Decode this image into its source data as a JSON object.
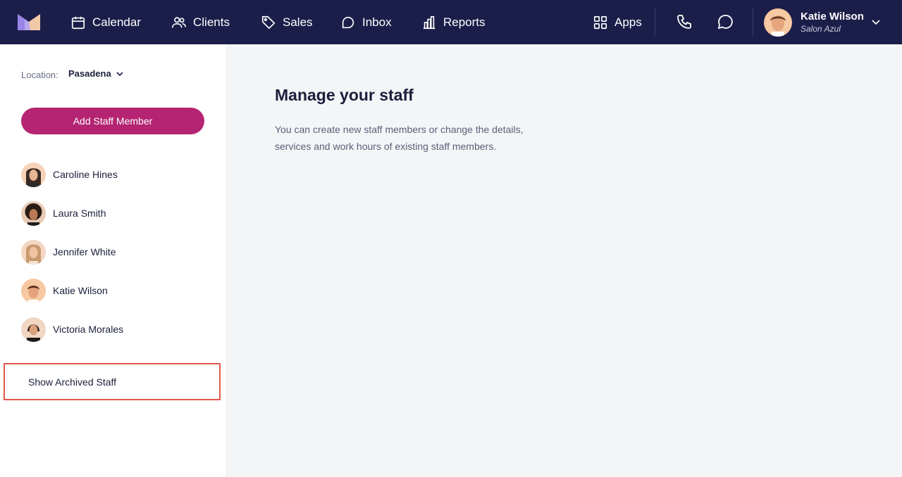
{
  "nav": {
    "items": [
      {
        "label": "Calendar",
        "icon": "calendar-icon"
      },
      {
        "label": "Clients",
        "icon": "users-icon"
      },
      {
        "label": "Sales",
        "icon": "tag-icon"
      },
      {
        "label": "Inbox",
        "icon": "chat-icon"
      },
      {
        "label": "Reports",
        "icon": "bar-chart-icon"
      }
    ],
    "apps_label": "Apps",
    "phone_icon": "phone-icon",
    "message_icon": "message-icon"
  },
  "user": {
    "name": "Katie Wilson",
    "salon": "Salon Azul"
  },
  "sidebar": {
    "location_label": "Location:",
    "location_value": "Pasadena",
    "add_button": "Add Staff Member",
    "staff": [
      {
        "name": "Caroline Hines"
      },
      {
        "name": "Laura Smith"
      },
      {
        "name": "Jennifer White"
      },
      {
        "name": "Katie Wilson"
      },
      {
        "name": "Victoria Morales"
      }
    ],
    "archived_label": "Show Archived Staff"
  },
  "main": {
    "title": "Manage your staff",
    "description": "You can create new staff members or change the details, services and work hours of existing staff members."
  },
  "colors": {
    "topbar": "#1c1e4a",
    "accent": "#b42472",
    "highlight": "#e2584a"
  }
}
